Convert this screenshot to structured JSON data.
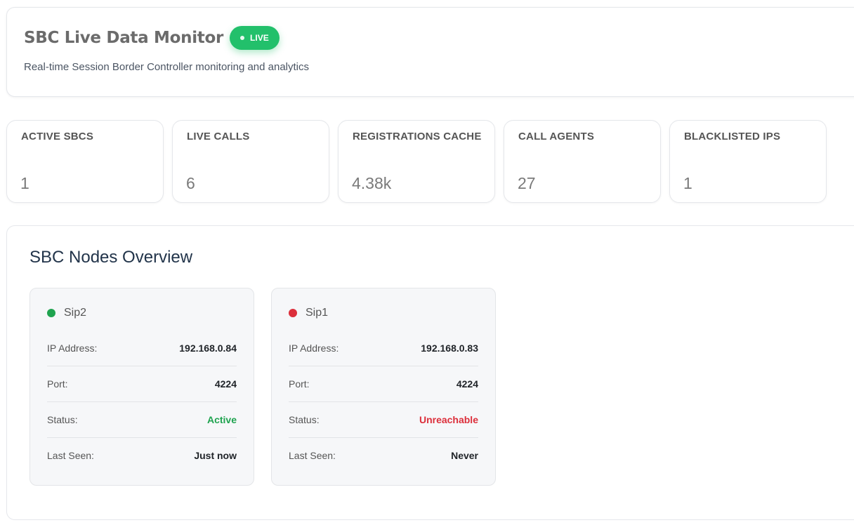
{
  "header": {
    "title": "SBC Live Data Monitor",
    "badge": "LIVE",
    "subtitle": "Real-time Session Border Controller monitoring and analytics"
  },
  "stats": [
    {
      "label": "ACTIVE SBCS",
      "value": "1"
    },
    {
      "label": "LIVE CALLS",
      "value": "6"
    },
    {
      "label": "REGISTRATIONS CACHE",
      "value": "4.38k"
    },
    {
      "label": "CALL AGENTS",
      "value": "27"
    },
    {
      "label": "BLACKLISTED IPS",
      "value": "1"
    }
  ],
  "nodes_panel": {
    "title": "SBC Nodes Overview",
    "nodes": [
      {
        "name": "Sip2",
        "status_color": "#1fa34f",
        "ip_label": "IP Address:",
        "ip": "192.168.0.84",
        "port_label": "Port:",
        "port": "4224",
        "status_label": "Status:",
        "status": "Active",
        "seen_label": "Last Seen:",
        "seen": "Just now"
      },
      {
        "name": "Sip1",
        "status_color": "#dc2f3b",
        "ip_label": "IP Address:",
        "ip": "192.168.0.83",
        "port_label": "Port:",
        "port": "4224",
        "status_label": "Status:",
        "status": "Unreachable",
        "seen_label": "Last Seen:",
        "seen": "Never"
      }
    ]
  }
}
